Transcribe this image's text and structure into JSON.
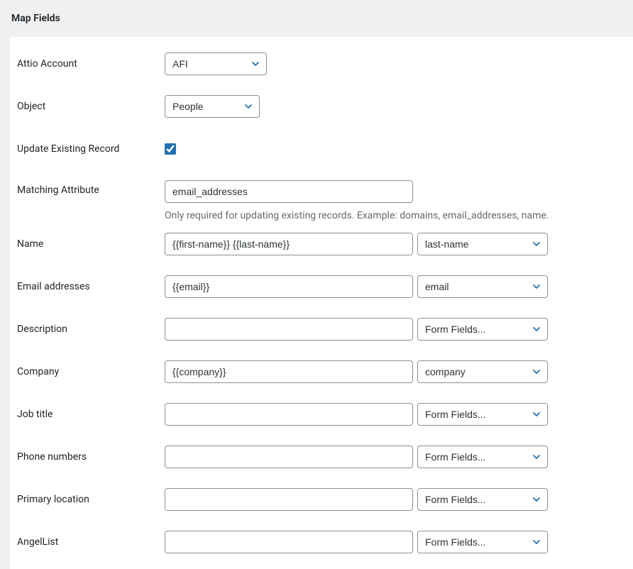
{
  "header": {
    "title": "Map Fields"
  },
  "attio_account": {
    "label": "Attio Account",
    "value": "AFI"
  },
  "object": {
    "label": "Object",
    "value": "People"
  },
  "update_existing": {
    "label": "Update Existing Record",
    "checked": true
  },
  "matching_attribute": {
    "label": "Matching Attribute",
    "value": "email_addresses",
    "helper": "Only required for updating existing records. Example: domains, email_addresses, name."
  },
  "fields": {
    "name": {
      "label": "Name",
      "text_value": "{{first-name}} {{last-name}}",
      "select_value": "last-name"
    },
    "email_addresses": {
      "label": "Email addresses",
      "text_value": "{{email}}",
      "select_value": "email"
    },
    "description": {
      "label": "Description",
      "text_value": "",
      "select_value": "Form Fields..."
    },
    "company": {
      "label": "Company",
      "text_value": "{{company}}",
      "select_value": "company"
    },
    "job_title": {
      "label": "Job title",
      "text_value": "",
      "select_value": "Form Fields..."
    },
    "phone_numbers": {
      "label": "Phone numbers",
      "text_value": "",
      "select_value": "Form Fields..."
    },
    "primary_location": {
      "label": "Primary location",
      "text_value": "",
      "select_value": "Form Fields..."
    },
    "angellist": {
      "label": "AngelList",
      "text_value": "",
      "select_value": "Form Fields..."
    }
  }
}
